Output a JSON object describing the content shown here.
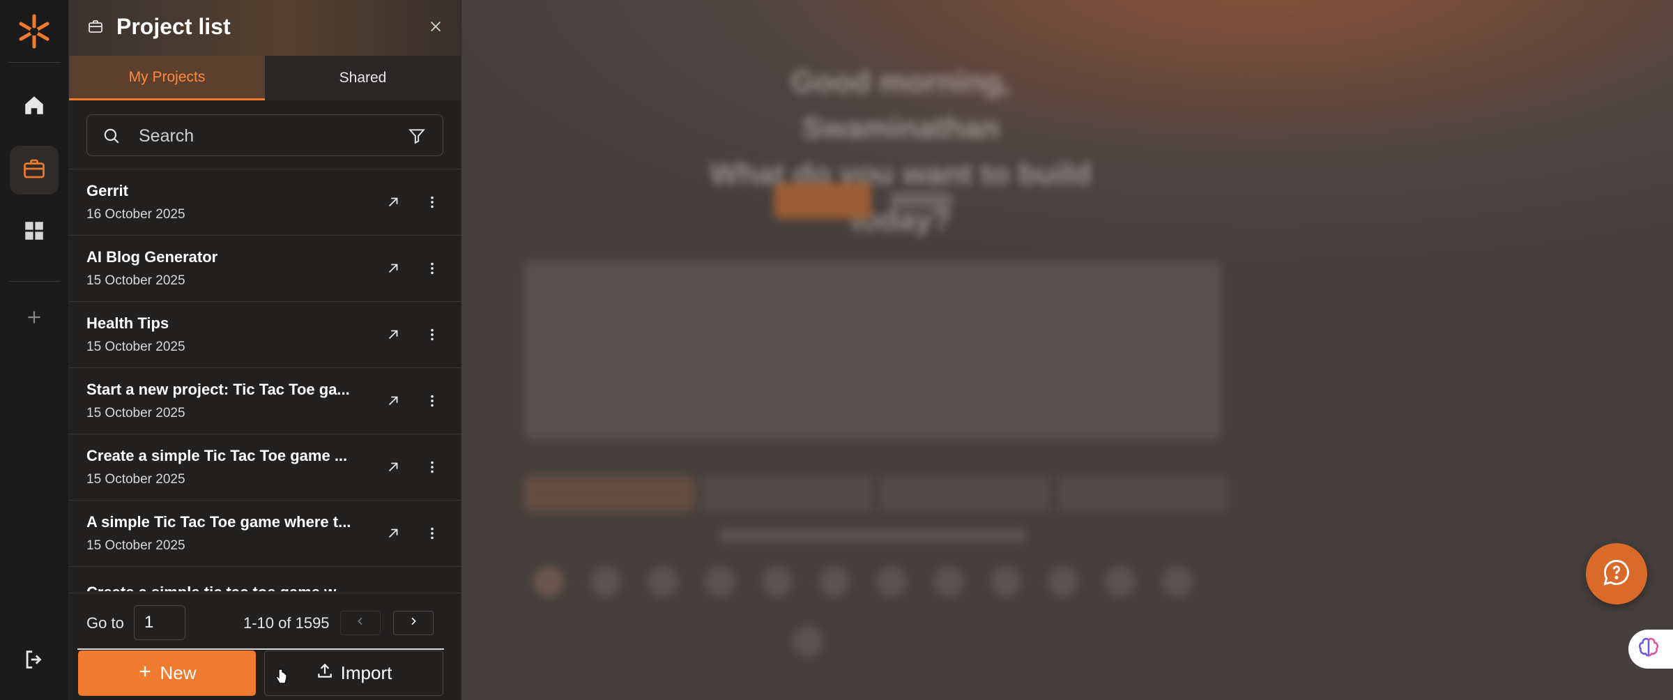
{
  "rail": {
    "items": [
      {
        "name": "home",
        "icon": "home-icon"
      },
      {
        "name": "projects",
        "icon": "briefcase-icon",
        "active": true
      },
      {
        "name": "templates",
        "icon": "grid-icon"
      },
      {
        "name": "add",
        "icon": "plus-icon"
      }
    ],
    "bottom_icon": "logout-icon",
    "accent_color": "#f07a2e"
  },
  "panel": {
    "title": "Project list",
    "tabs": [
      {
        "label": "My Projects",
        "active": true
      },
      {
        "label": "Shared",
        "active": false
      }
    ],
    "search": {
      "placeholder": "Search"
    },
    "projects": [
      {
        "name": "Gerrit",
        "date": "16 October 2025"
      },
      {
        "name": "AI Blog Generator",
        "date": "15 October 2025"
      },
      {
        "name": "Health Tips",
        "date": "15 October 2025"
      },
      {
        "name": "Start a new project: Tic Tac Toe ga...",
        "date": "15 October 2025"
      },
      {
        "name": "Create a simple Tic Tac Toe game ...",
        "date": "15 October 2025"
      },
      {
        "name": "A simple Tic Tac Toe game where t...",
        "date": "15 October 2025"
      },
      {
        "name": "Create a simple tic tac toe game w...",
        "date": ""
      }
    ],
    "pagination": {
      "goto_label": "Go to",
      "page": "1",
      "range": "1-10 of 1595"
    },
    "new_label": "New",
    "import_label": "Import"
  },
  "background": {
    "greeting_line1": "Good morning, Swaminathan",
    "greeting_line2": "What do you want to build today?"
  }
}
